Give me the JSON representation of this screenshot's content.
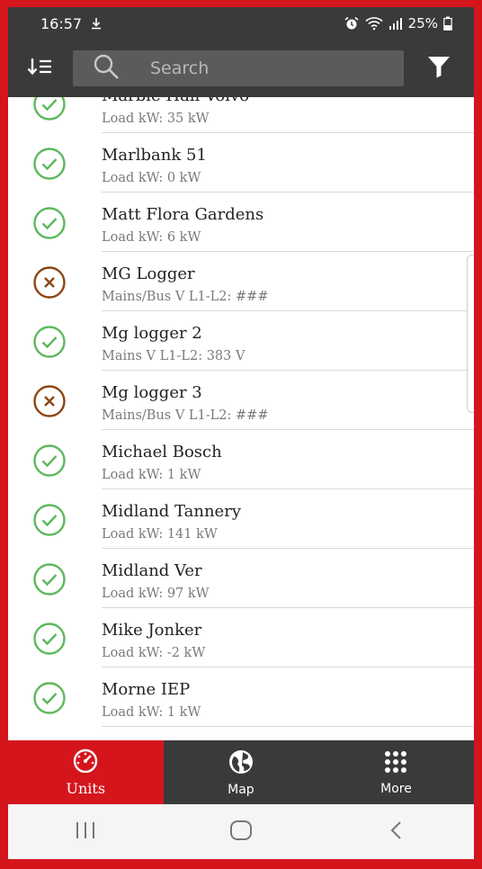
{
  "status_bar": {
    "time": "16:57",
    "battery": "25%"
  },
  "toolbar": {
    "search_placeholder": "Search",
    "sort_icon": "sort-icon",
    "filter_icon": "filter-icon"
  },
  "units": [
    {
      "name": "Marble Hall Volvo",
      "detail": "Load kW: 35 kW",
      "status": "ok"
    },
    {
      "name": "Marlbank 51",
      "detail": "Load kW: 0 kW",
      "status": "ok"
    },
    {
      "name": "Matt Flora Gardens",
      "detail": "Load kW: 6 kW",
      "status": "ok"
    },
    {
      "name": "MG Logger",
      "detail": "Mains/Bus V L1-L2: ###",
      "status": "error"
    },
    {
      "name": "Mg logger 2",
      "detail": "Mains V L1-L2: 383 V",
      "status": "ok"
    },
    {
      "name": "Mg logger 3",
      "detail": "Mains/Bus V L1-L2: ###",
      "status": "error"
    },
    {
      "name": "Michael Bosch",
      "detail": "Load kW: 1 kW",
      "status": "ok"
    },
    {
      "name": "Midland Tannery",
      "detail": "Load kW: 141 kW",
      "status": "ok"
    },
    {
      "name": "Midland Ver",
      "detail": "Load kW: 97 kW",
      "status": "ok"
    },
    {
      "name": "Mike Jonker",
      "detail": "Load kW: -2 kW",
      "status": "ok"
    },
    {
      "name": "Morne IEP",
      "detail": "Load kW: 1 kW",
      "status": "ok"
    }
  ],
  "bottom_nav": {
    "units_label": "Units",
    "map_label": "Map",
    "more_label": "More"
  },
  "colors": {
    "accent": "#d4161c",
    "ok": "#5cb85c",
    "error": "#8b4513",
    "bar": "#3a3a3a"
  }
}
